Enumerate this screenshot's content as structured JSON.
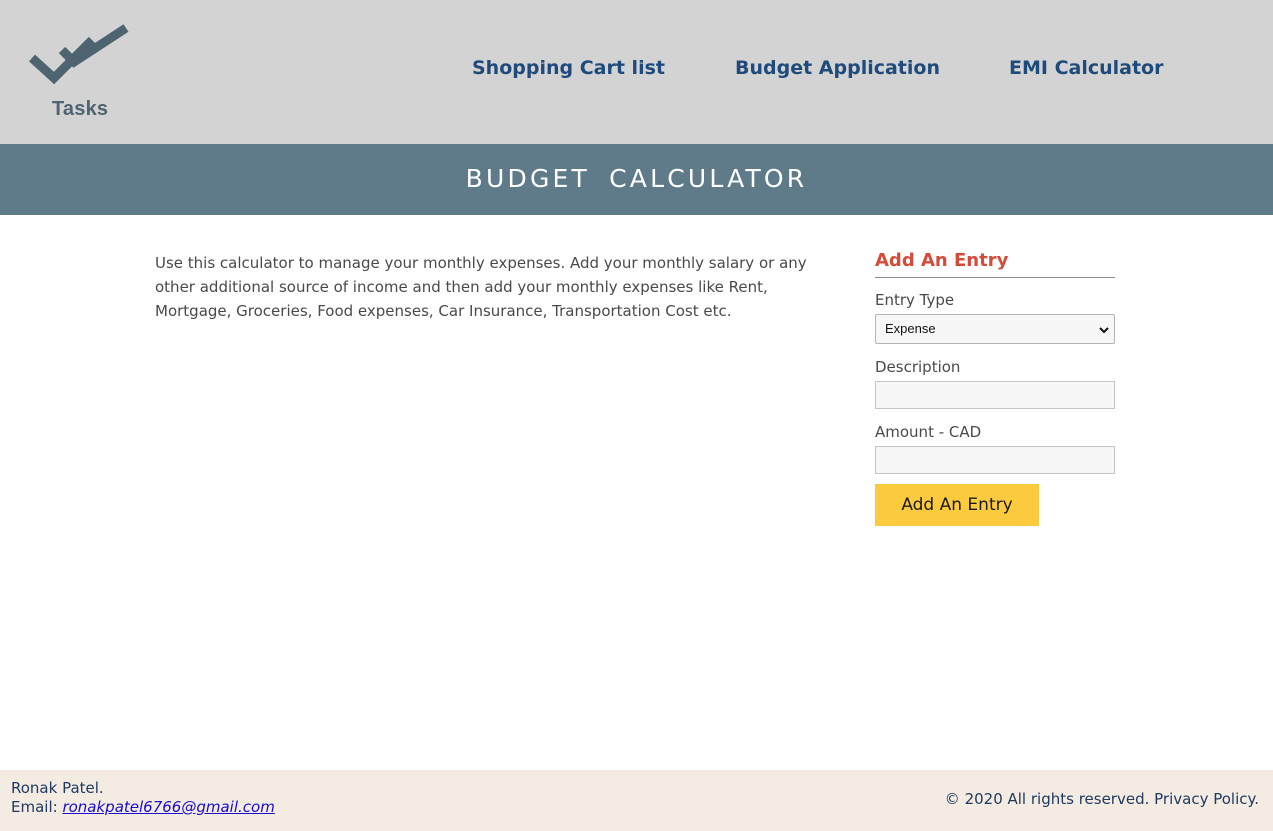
{
  "header": {
    "logo_text": "Tasks",
    "nav": [
      {
        "label": "Shopping Cart list"
      },
      {
        "label": "Budget Application"
      },
      {
        "label": "EMI Calculator"
      }
    ]
  },
  "banner": {
    "title": "BUDGET CALCULATOR"
  },
  "main": {
    "intro": "Use this calculator to manage your monthly expenses. Add your monthly salary or any other additional source of income and then add your monthly expenses like Rent, Mortgage, Groceries, Food expenses, Car Insurance, Transportation Cost etc."
  },
  "entry_form": {
    "heading": "Add An Entry",
    "entry_type_label": "Entry Type",
    "entry_type_value": "Expense",
    "description_label": "Description",
    "description_value": "",
    "amount_label": "Amount - CAD",
    "amount_value": "",
    "submit_label": "Add An Entry"
  },
  "footer": {
    "name": "Ronak Patel.",
    "email_label": "Email:",
    "email": "ronakpatel6766@gmail.com",
    "copyright": "© 2020 All rights reserved. Privacy Policy."
  },
  "colors": {
    "header_bg": "#d3d3d3",
    "banner_bg": "#5f7b89",
    "nav_link": "#1f4a7c",
    "heading_accent": "#d44b3a",
    "button_bg": "#fccb3d",
    "footer_bg": "#f4ebe3"
  },
  "icons": {
    "logo": "double-check-icon",
    "select_arrow": "chevron-down-icon"
  }
}
